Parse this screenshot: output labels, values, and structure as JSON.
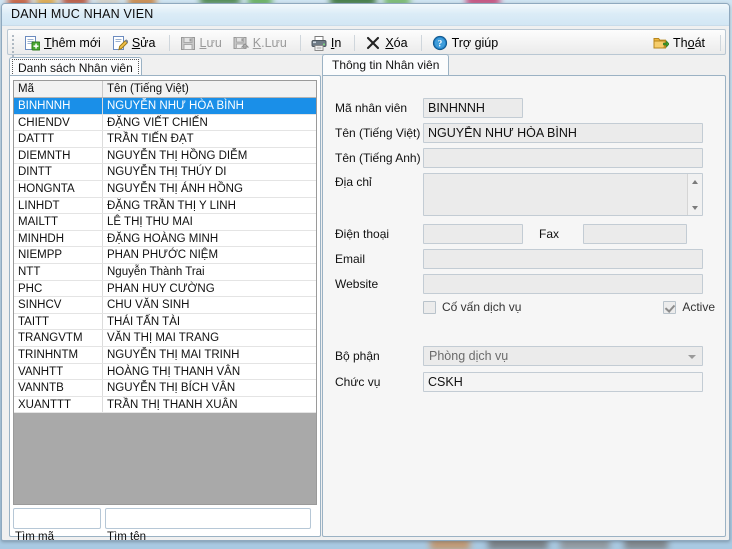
{
  "window": {
    "title": "DANH MUC NHAN VIEN"
  },
  "toolbar": {
    "add_label": "Thêm mới",
    "add_accel": "T",
    "edit_label": "Sửa",
    "edit_accel": "S",
    "save_label": "Lưu",
    "save_accel": "L",
    "saveclose_label": "K.Lưu",
    "saveclose_accel": "K",
    "print_label": "In",
    "print_accel": "I",
    "delete_label": "Xóa",
    "delete_accel": "X",
    "help_label": "Trợ giúp",
    "exit_label": "Thoát",
    "exit_accel": "o",
    "icons": {
      "add": "add-page-icon",
      "edit": "edit-pencil-icon",
      "save": "floppy-disk-icon",
      "saveclose": "floppy-disk-close-icon",
      "print": "printer-icon",
      "delete": "x-delete-icon",
      "help": "question-circle-icon",
      "exit": "exit-folder-icon"
    }
  },
  "tabs": {
    "left": "Danh sách Nhân viên",
    "right": "Thông tin Nhân viên"
  },
  "grid": {
    "columns": [
      "Mã",
      "Tên (Tiếng Việt)"
    ],
    "selected_index": 0,
    "rows": [
      {
        "code": "BINHNNH",
        "name": "NGUYỄN NHƯ HÒA BÌNH"
      },
      {
        "code": "CHIENDV",
        "name": "ĐẶNG VIẾT CHIẾN"
      },
      {
        "code": "DATTT",
        "name": "TRẦN TIẾN ĐẠT"
      },
      {
        "code": "DIEMNTH",
        "name": "NGUYỄN THỊ HỒNG DIỄM"
      },
      {
        "code": "DINTT",
        "name": "NGUYỄN THỊ THÚY DI"
      },
      {
        "code": "HONGNTA",
        "name": "NGUYỄN THỊ ÁNH HỒNG"
      },
      {
        "code": "LINHDT",
        "name": "ĐẶNG TRẦN THỊ Y LINH"
      },
      {
        "code": "MAILTT",
        "name": "LÊ THỊ THU MAI"
      },
      {
        "code": "MINHDH",
        "name": "ĐẶNG HOÀNG MINH"
      },
      {
        "code": "NIEMPP",
        "name": "PHAN PHƯỚC NIỆM"
      },
      {
        "code": "NTT",
        "name": "Nguyễn Thành Trai"
      },
      {
        "code": "PHC",
        "name": "PHAN HUY CƯỜNG"
      },
      {
        "code": "SINHCV",
        "name": "CHU VĂN SINH"
      },
      {
        "code": "TAITT",
        "name": "THÁI TẤN TÀI"
      },
      {
        "code": "TRANGVTM",
        "name": "VĂN THỊ MAI TRANG"
      },
      {
        "code": "TRINHNTM",
        "name": "NGUYỄN THỊ MAI TRINH"
      },
      {
        "code": "VANHTT",
        "name": "HOÀNG THỊ THANH VÂN"
      },
      {
        "code": "VANNTB",
        "name": "NGUYỄN THỊ BÍCH VÂN"
      },
      {
        "code": "XUANTTT",
        "name": "TRẦN THỊ THANH XUÂN"
      }
    ]
  },
  "search": {
    "code_value": "",
    "name_value": "",
    "code_label": "Tìm mã",
    "name_label": "Tìm tên"
  },
  "form": {
    "employee_code_label": "Mã nhân viên",
    "employee_code_value": "BINHNNH",
    "name_vi_label": "Tên (Tiếng Việt)",
    "name_vi_value": "NGUYỄN NHƯ HÒA BÌNH",
    "name_en_label": "Tên (Tiếng Anh)",
    "name_en_value": "",
    "address_label": "Địa chỉ",
    "address_value": "",
    "phone_label": "Điện thoại",
    "phone_value": "",
    "fax_label": "Fax",
    "fax_value": "",
    "email_label": "Email",
    "email_value": "",
    "website_label": "Website",
    "website_value": "",
    "advisor_checkbox_label": "Cố vấn dịch vụ",
    "advisor_checked": false,
    "active_checkbox_label": "Active",
    "active_checked": true,
    "department_label": "Bộ phận",
    "department_value": "Phòng dịch vụ",
    "position_label": "Chức vụ",
    "position_value": "CSKH"
  },
  "colors": {
    "selection_blue": "#1a8fe8",
    "window_border": "#8fa9bf",
    "field_disabled": "#ebebeb",
    "grid_filler_gray": "#a9a9a9"
  }
}
